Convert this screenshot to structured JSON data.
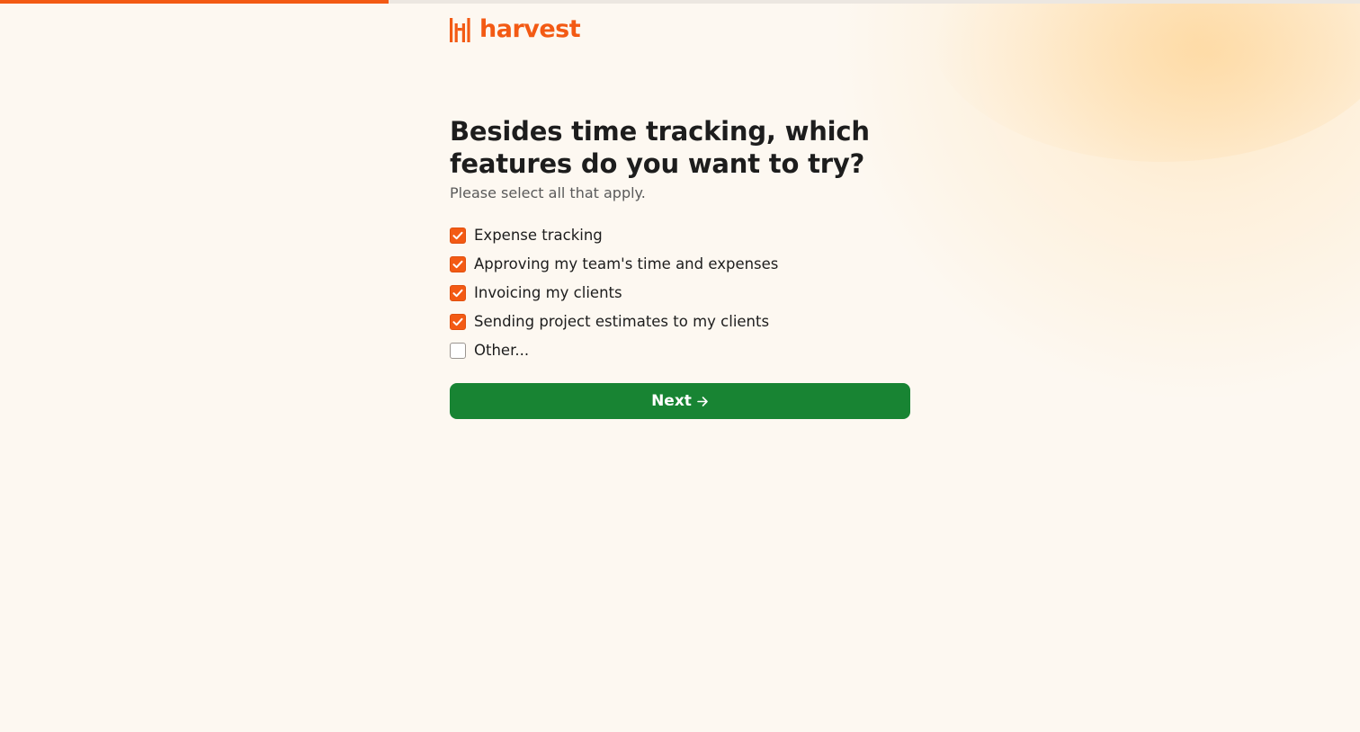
{
  "progress": {
    "fraction": 0.2857
  },
  "brand": {
    "name": "harvest",
    "color": "#f35a14",
    "logo_icon": "harvest-bars-icon"
  },
  "question": {
    "title": "Besides time tracking, which features do you want to try?",
    "subtitle": "Please select all that apply."
  },
  "options": [
    {
      "label": "Expense tracking",
      "checked": true
    },
    {
      "label": "Approving my team's time and expenses",
      "checked": true
    },
    {
      "label": "Invoicing my clients",
      "checked": true
    },
    {
      "label": "Sending project estimates to my clients",
      "checked": true
    },
    {
      "label": "Other...",
      "checked": false
    }
  ],
  "next_button": {
    "label": "Next",
    "icon": "arrow-right-icon",
    "color": "#188433"
  }
}
